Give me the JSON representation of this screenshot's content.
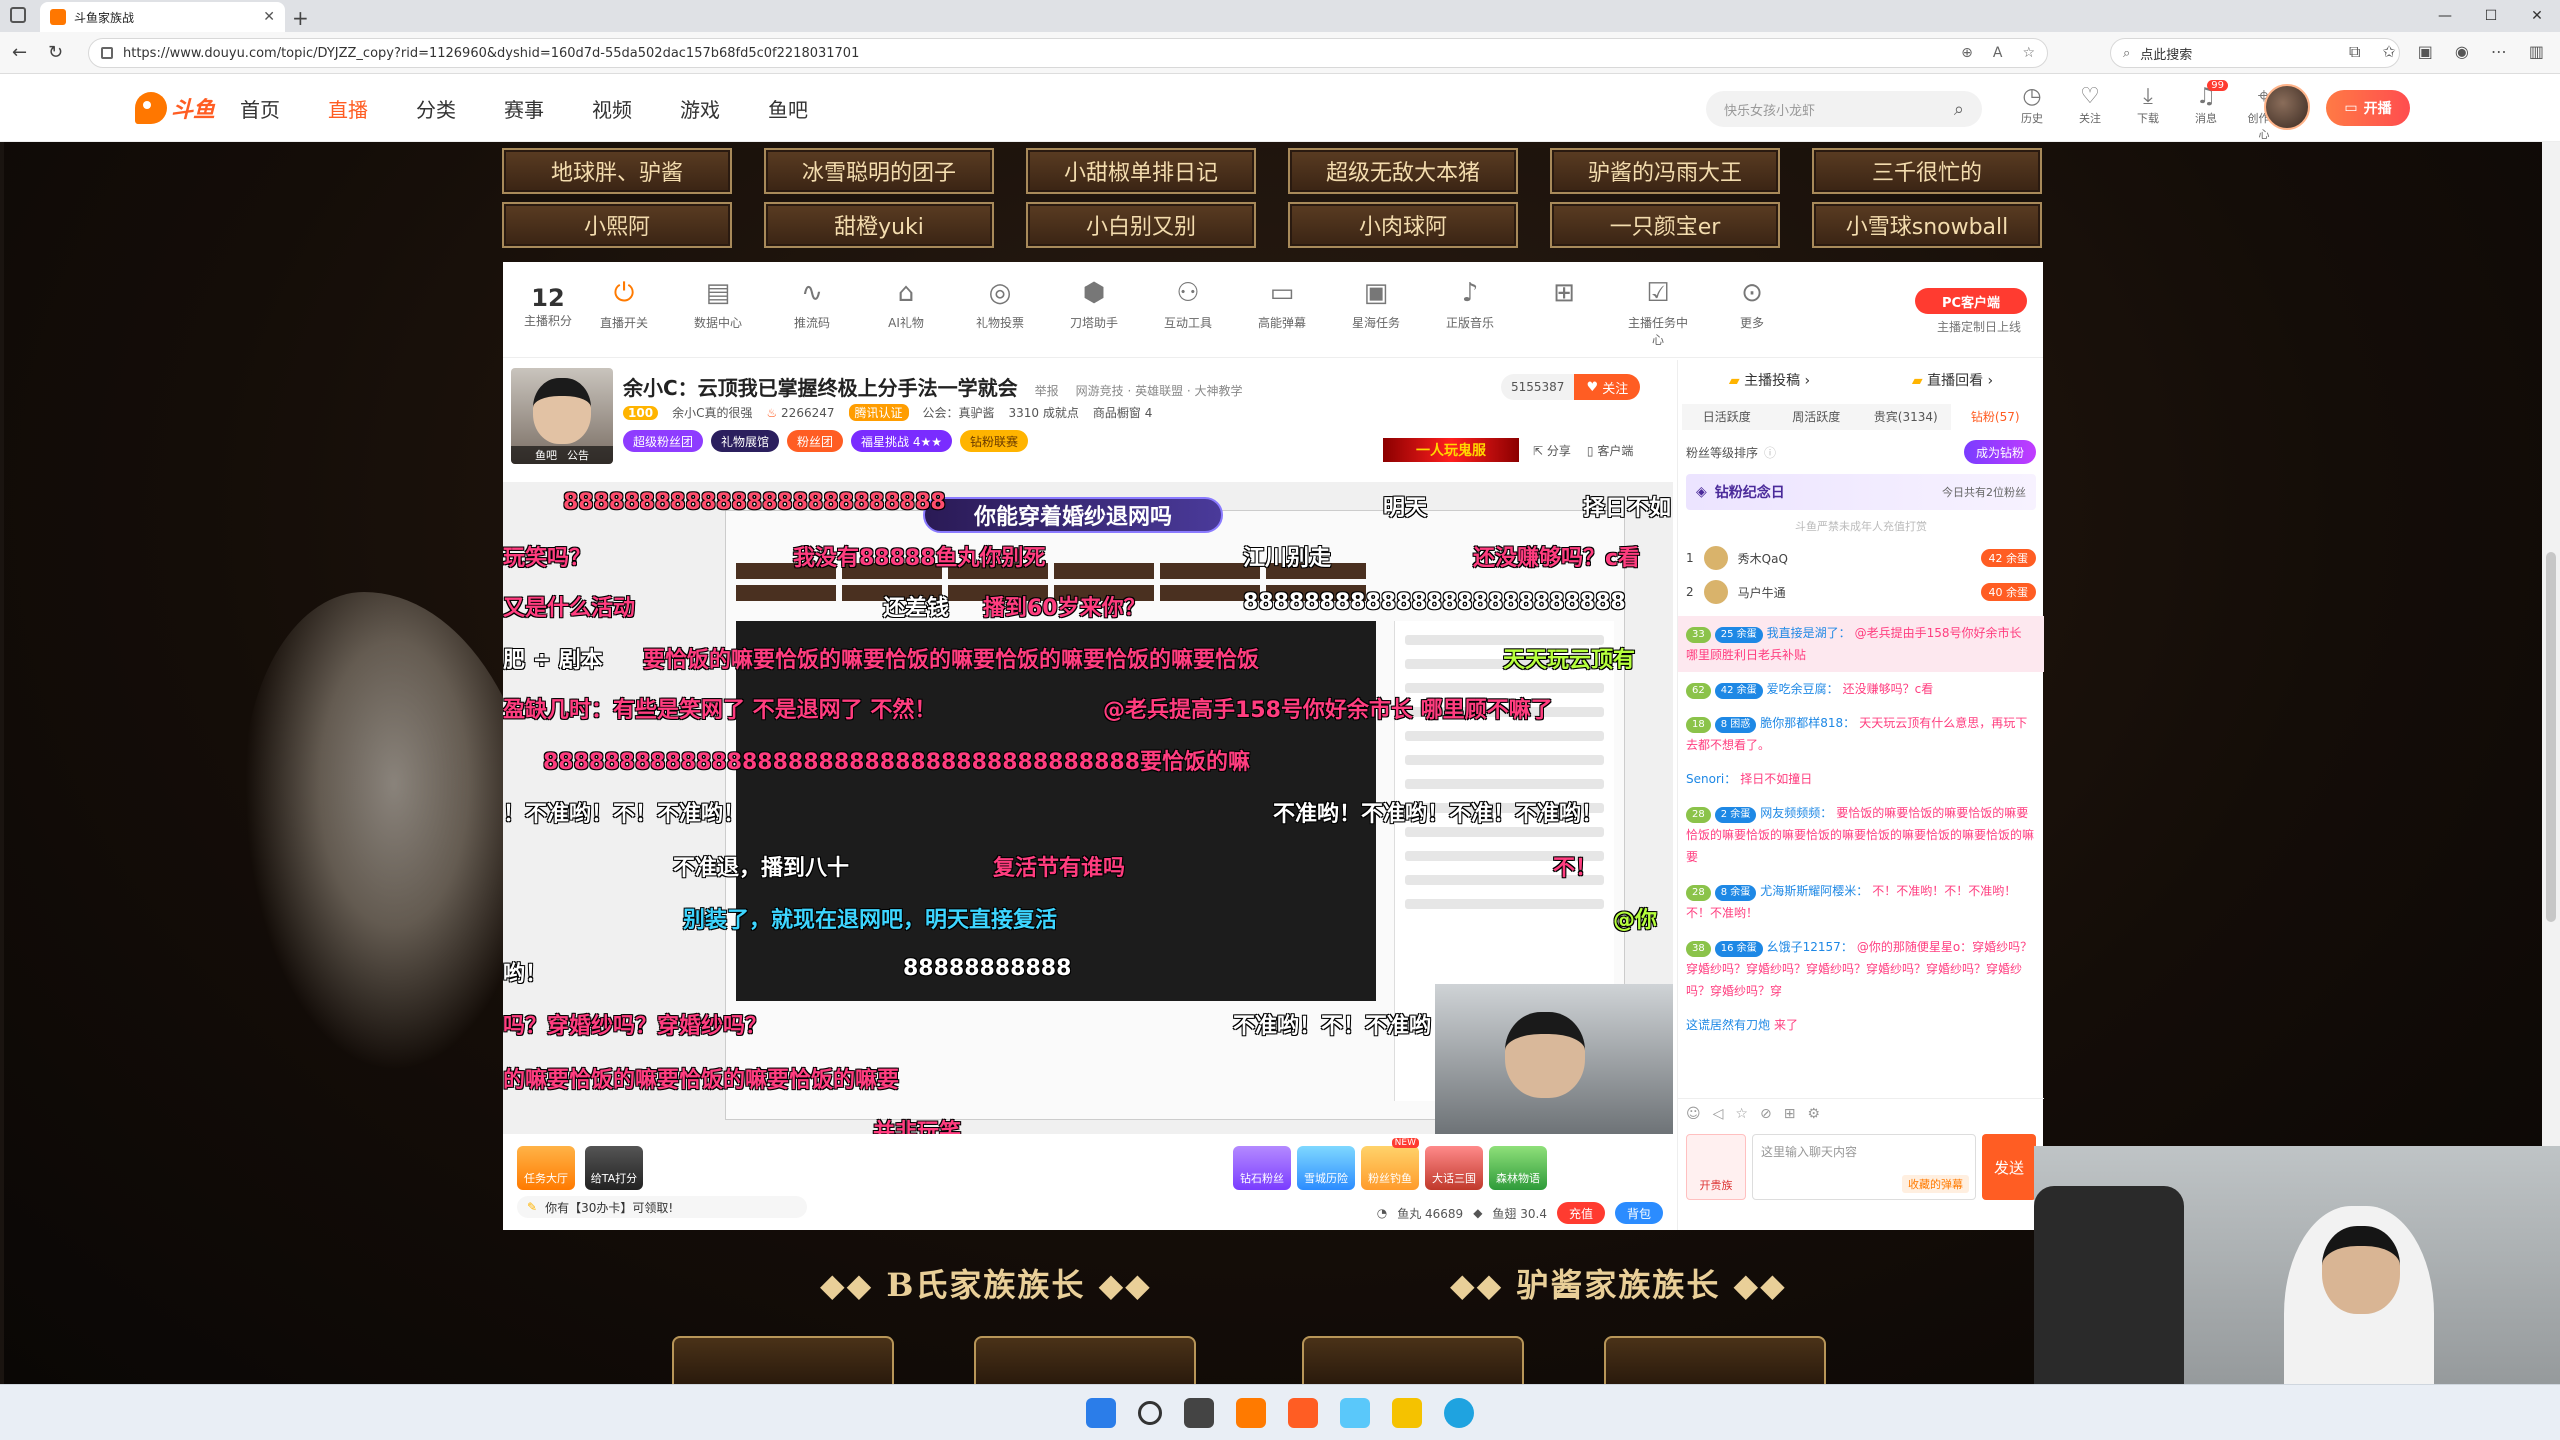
{
  "browser": {
    "tab_title": "斗鱼家族战",
    "url": "https://www.douyu.com/topic/DYJZZ_copy?rid=1126960&dyshid=160d7d-55da502dac157b68fd5c0f2218031701",
    "search_placeholder": "点此搜索"
  },
  "site": {
    "logo_text": "斗鱼",
    "nav": [
      "首页",
      "直播",
      "分类",
      "赛事",
      "视频",
      "游戏",
      "鱼吧"
    ],
    "search_placeholder": "快乐女孩小龙虾",
    "header_icons": [
      {
        "label": "历史"
      },
      {
        "label": "关注"
      },
      {
        "label": "下载"
      },
      {
        "label": "消息",
        "badge": "99"
      },
      {
        "label": "创作中心"
      }
    ],
    "start_live": "开播"
  },
  "families": [
    "地球胖、驴酱",
    "冰雪聪明的团子",
    "小甜椒单排日记",
    "超级无敌大本猪",
    "驴酱的冯雨大王",
    "三千很忙的",
    "小熙阿",
    "甜橙yuki",
    "小白别又别",
    "小肉球阿",
    "一只颜宝er",
    "小雪球snowball"
  ],
  "toolbar": {
    "score_value": "12",
    "score_label": "主播积分",
    "tools": [
      "直播开关",
      "数据中心",
      "推流码",
      "AI礼物",
      "礼物投票",
      "刀塔助手",
      "互动工具",
      "高能弹幕",
      "星海任务",
      "正版音乐",
      "",
      "主播任务中心",
      "更多"
    ],
    "pc_client": "PC客户端",
    "pc_sub": "主播定制日上线"
  },
  "room": {
    "title": "余小C：云顶我已掌握终极上分手法一学就会",
    "report": "举报",
    "category": "网游竞技 · 英雄联盟 · 大神教学",
    "level": "100",
    "streamer": "余小C真的很强",
    "hot": "2266247",
    "cert": "腾讯认证",
    "notice": "公会：真驴酱",
    "achieve": "3310 成就点",
    "shop": "商品橱窗 4",
    "follower_count": "5155387",
    "follow_button": "关注",
    "avatar_tag_left": "鱼吧",
    "avatar_tag_right": "公告",
    "badges": [
      "超级粉丝团",
      "礼物展馆",
      "粉丝团",
      "福星挑战 4★★",
      "钻粉联赛"
    ],
    "promo": "一人玩鬼服",
    "share": "分享",
    "client": "客户端"
  },
  "danmaku": {
    "gift_banner": "你能穿着婚纱退网吗",
    "lines": [
      {
        "text": "8888888888888888888888888",
        "color": "#ff4d6d"
      },
      {
        "text": "明天",
        "color": "#ffffff"
      },
      {
        "text": "择日不如",
        "color": "#ffffff"
      },
      {
        "text": "玩笑吗？",
        "color": "#ff3d7f"
      },
      {
        "text": "我没有88888鱼丸你别死",
        "color": "#ff3d7f"
      },
      {
        "text": "江川别走",
        "color": "#ffffff"
      },
      {
        "text": "还没赚够吗？c看",
        "color": "#ff3d7f"
      },
      {
        "text": "又是什么活动",
        "color": "#ff3d7f"
      },
      {
        "text": "还差钱",
        "color": "#ffffff"
      },
      {
        "text": "播到60岁来你？",
        "color": "#ff3d7f"
      },
      {
        "text": "8888888888888888888888888",
        "color": "#ffffff"
      },
      {
        "text": "肥 ÷ 剧本",
        "color": "#ffffff"
      },
      {
        "text": "要恰饭的嘛要恰饭的嘛要恰饭的嘛要恰饭的嘛要恰饭的嘛要恰饭",
        "color": "#ff3d7f"
      },
      {
        "text": "天天玩云顶有",
        "color": "#b6ff3d"
      },
      {
        "text": "盈缺几时：有些是笑网了 不是退网了 不然！",
        "color": "#ff3d7f"
      },
      {
        "text": "@老兵提高手158号你好余市长 哪里顾不嘛了",
        "color": "#ff3d7f"
      },
      {
        "text": "888888888888888888888888888888888888888要恰饭的嘛",
        "color": "#ff3d7f"
      },
      {
        "text": "！不准哟！不！不准哟！",
        "color": "#ffffff"
      },
      {
        "text": "不准哟！不准哟！不准！不准哟！",
        "color": "#ffffff"
      },
      {
        "text": "不准退，播到八十",
        "color": "#ffffff"
      },
      {
        "text": "复活节有谁吗",
        "color": "#ff3d7f"
      },
      {
        "text": "不！",
        "color": "#ff3d7f"
      },
      {
        "text": "别装了，就现在退网吧，明天直接复活",
        "color": "#3dd5ff"
      },
      {
        "text": "@你",
        "color": "#b6ff3d"
      },
      {
        "text": "哟！",
        "color": "#ffffff"
      },
      {
        "text": "88888888888",
        "color": "#ffffff"
      },
      {
        "text": "吗？穿婚纱吗？穿婚纱吗？",
        "color": "#ff3d7f"
      },
      {
        "text": "不准哟！不！不准哟",
        "color": "#ffffff"
      },
      {
        "text": "的嘛要恰饭的嘛要恰饭的嘛要恰饭的嘛要",
        "color": "#ff3d7f"
      },
      {
        "text": "并非玩笑",
        "color": "#ff3d7f"
      }
    ]
  },
  "bottom": {
    "icons": [
      "任务大厅",
      "给TA打分",
      "钻石粉丝",
      "雪城历险",
      "粉丝钓鱼",
      "大话三国",
      "森林物语"
    ],
    "new_badge": "NEW",
    "tip": "你有【30办卡】可领取!",
    "fish_balls": "鱼丸 46689",
    "fish_wings": "鱼翅 30.4",
    "recharge": "充值",
    "backpack": "背包"
  },
  "chat": {
    "top_tabs": [
      "主播投稿",
      "直播回看"
    ],
    "tabs": [
      "日活跃度",
      "周活跃度",
      "贵宾(3134)",
      "钻粉(57)"
    ],
    "fan_rank": "粉丝等级排序",
    "become_diamond": "成为钻粉",
    "diamond_day": "钻粉纪念日",
    "diamond_day_right": "今日共有2位粉丝",
    "noble_tip": "斗鱼严禁未成年人充值打赏",
    "rank": [
      {
        "pos": "1",
        "name": "秀木QaQ",
        "medal": "42 余蛋"
      },
      {
        "pos": "2",
        "name": "马户牛通",
        "medal": "40 余蛋"
      }
    ],
    "messages": [
      {
        "lv": "33",
        "medal": "25 余蛋",
        "name": "我直接是湖了：",
        "text": "@老兵提由手158号你好余市长 哪里顾胜利日老兵补贴",
        "hl": true
      },
      {
        "lv": "62",
        "medal": "42 余蛋",
        "name": "爱吃余豆腐：",
        "text": "还没赚够吗？c看",
        "hl": false
      },
      {
        "lv": "18",
        "medal": "8 困惑",
        "name": "脆你那都样818：",
        "text": "天天玩云顶有什么意思，再玩下去都不想看了。",
        "hl": false
      },
      {
        "lv": "",
        "medal": "",
        "name": "Senori：",
        "text": "择日不如撞日",
        "hl": false
      },
      {
        "lv": "28",
        "medal": "2 余蛋",
        "name": "网友频频频：",
        "text": "要恰饭的嘛要恰饭的嘛要恰饭的嘛要恰饭的嘛要恰饭的嘛要恰饭的嘛要恰饭的嘛要恰饭的嘛要恰饭的嘛要",
        "hl": false
      },
      {
        "lv": "28",
        "medal": "8 余蛋",
        "name": "尤海斯斯耀阿樱米：",
        "text": "不！不准哟！不！不准哟！不！不准哟！",
        "hl": false
      },
      {
        "lv": "38",
        "medal": "16 余蛋",
        "name": "幺饿子12157：",
        "text": "@你的那随便星星o：穿婚纱吗？穿婚纱吗？穿婚纱吗？穿婚纱吗？穿婚纱吗？穿婚纱吗？穿婚纱吗？穿婚纱吗？穿",
        "hl": false
      },
      {
        "lv": "",
        "medal": "",
        "name": "这谎居然有刀炮",
        "text": "来了",
        "hl": false
      }
    ],
    "input_placeholder": "这里输入聊天内容",
    "noble_label": "开贵族",
    "exp_label": "收藏的弹幕",
    "send": "发送"
  },
  "sections": [
    "B氏家族族长",
    "驴酱家族族长"
  ]
}
